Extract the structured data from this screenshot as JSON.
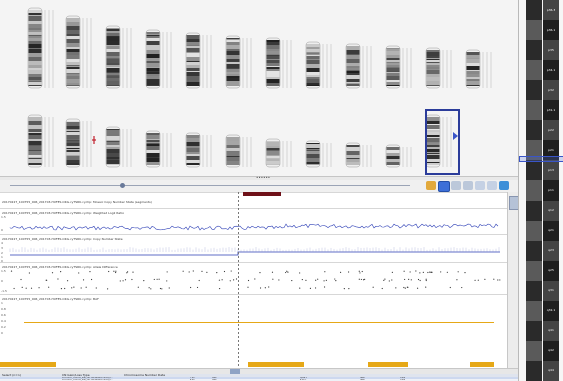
{
  "karyotype": {
    "row1_count": 12,
    "row2_count": 11,
    "selected_chromosome_index": 10
  },
  "divider": {
    "grip": "••••••"
  },
  "toolbar": {
    "icons": [
      "pin-icon",
      "view-icon",
      "link-icon",
      "chart-icon",
      "zoom-in-icon",
      "zoom-out-icon",
      "fit-icon"
    ],
    "accent": "#3d6fd8"
  },
  "tracks": [
    {
      "title": "20170227_100755_006_201703-HUFES.OKG.cyTSRK.cychp: Mosaic Copy Number State (segments)"
    },
    {
      "title": "20170227_100755_006_201703-HUFES.OKG.cyTSRK.cychp: Weighted Log2 Ratio",
      "axis": [
        "1.5",
        "0"
      ]
    },
    {
      "title": "20170227_100755_006_201703-HUFES.OKG.cyTSRK.cychp: Copy Number State",
      "axis": [
        "4",
        "3",
        "2",
        "1",
        "0"
      ]
    },
    {
      "title": "20170227_100755_006_201703-HUFES.OKG.cyTSRK.cychp: Allele Difference",
      "axis": [
        "1.5",
        "0",
        "-1.5"
      ]
    },
    {
      "title": "20170227_100755_006_201703-HUFES.OKG.cyTSRK.cychp: BAF",
      "axis": [
        "1",
        "0.8",
        "0.6",
        "0.4",
        "0.2",
        "0"
      ]
    }
  ],
  "table": {
    "headers": [
      "Select (n=n)",
      "CN Gain/Loss Type",
      "Chromosome Number Date",
      "",
      "",
      "",
      "",
      ""
    ],
    "rows": [
      [
        "",
        "",
        "20170227_100755_006_201703-HUFES.OKG.cyT...",
        "7.00",
        "Loss",
        "1p36.1",
        "Gain",
        "1960"
      ],
      [
        "",
        "",
        "20170227_100755_006_201703-HUFES.OKG.cyT...",
        "4.00",
        "Loss",
        "4.35.1",
        "Gain",
        "1960"
      ]
    ]
  },
  "ideogram": {
    "labels": [
      "p36.3",
      "p36.1",
      "p35",
      "p34.1",
      "p32",
      "p31.1",
      "p22",
      "p21",
      "p13",
      "p11",
      "q12",
      "q21",
      "q23",
      "q25",
      "q31",
      "q32.1",
      "q41",
      "q42",
      "q44"
    ]
  },
  "colors": {
    "trace_blue": "#2b3db5",
    "baf_yellow": "#e6a817",
    "marker_red": "#c01f2b"
  }
}
